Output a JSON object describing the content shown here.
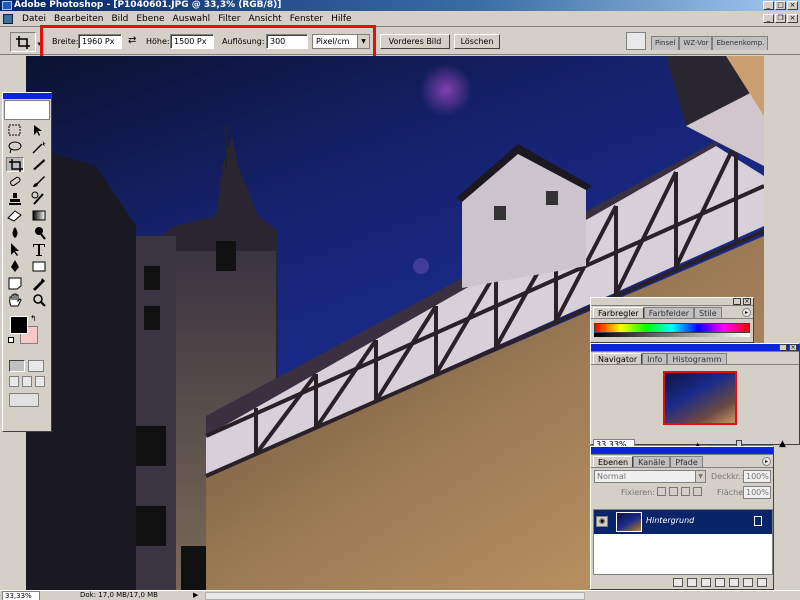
{
  "window": {
    "title": "Adobe Photoshop - [P1040601.JPG @ 33,3% (RGB/8)]"
  },
  "menu": {
    "items": [
      "Datei",
      "Bearbeiten",
      "Bild",
      "Ebene",
      "Auswahl",
      "Filter",
      "Ansicht",
      "Fenster",
      "Hilfe"
    ]
  },
  "options": {
    "width_label": "Breite:",
    "width_value": "1960 Px",
    "height_label": "Höhe:",
    "height_value": "1500 Px",
    "resolution_label": "Auflösung:",
    "resolution_value": "300",
    "unit_value": "Pixel/cm",
    "front_image_button": "Vorderes Bild",
    "clear_button": "Löschen",
    "well_tabs": [
      "Pinsel",
      "WZ-Vor",
      "Ebenenkomp."
    ]
  },
  "palettes": {
    "color": {
      "tabs": [
        "Farbregler",
        "Farbfelder",
        "Stile"
      ]
    },
    "navigator": {
      "tabs": [
        "Navigator",
        "Info",
        "Histogramm"
      ],
      "zoom": "33,33%"
    },
    "layers": {
      "tabs": [
        "Ebenen",
        "Kanäle",
        "Pfade"
      ],
      "blend_mode": "Normal",
      "opacity_label": "Deckkr.:",
      "opacity_value": "100%",
      "lock_label": "Fixieren:",
      "fill_label": "Fläche:",
      "fill_value": "100%",
      "layer_name": "Hintergrund"
    }
  },
  "status": {
    "zoom": "33,33%",
    "doc_info": "Dok: 17,0 MB/17,0 MB"
  },
  "colors": {
    "foreground": "#000000",
    "background": "#f6c8c8",
    "highlight": "#e01010"
  }
}
